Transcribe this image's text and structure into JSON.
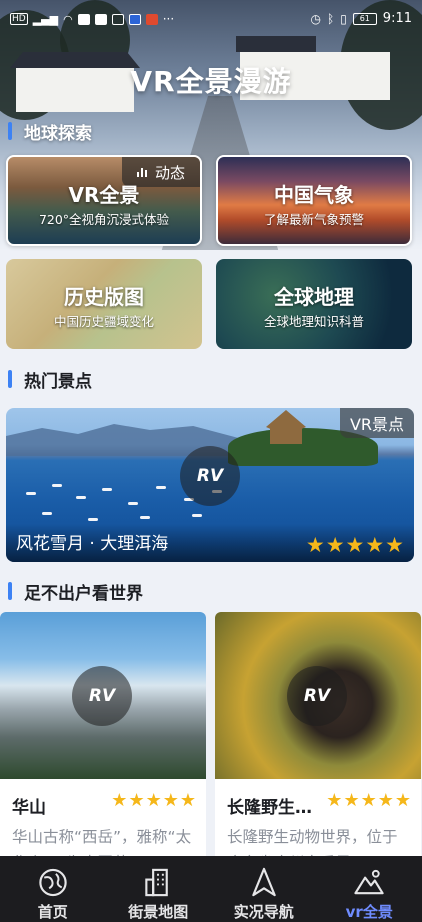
{
  "status_bar": {
    "time": "9:11",
    "battery": "61",
    "left_text": "HD",
    "more": "···"
  },
  "hero": {
    "title": "VR全景漫游"
  },
  "section_explore": {
    "title": "地球探索"
  },
  "grid": [
    {
      "title": "VR全景",
      "subtitle": "720°全视角沉浸式体验",
      "badge": "动态"
    },
    {
      "title": "中国气象",
      "subtitle": "了解最新气象预警"
    },
    {
      "title": "历史版图",
      "subtitle": "中国历史疆域变化"
    },
    {
      "title": "全球地理",
      "subtitle": "全球地理知识科普"
    }
  ],
  "section_hot": {
    "title": "热门景点"
  },
  "featured": {
    "tag": "VR景点",
    "rv": "RV",
    "name": "风花雪月 · 大理洱海",
    "stars": 5
  },
  "section_world": {
    "title": "足不出户看世界"
  },
  "cards": [
    {
      "name": "华山",
      "rv": "RV",
      "stars": 5,
      "desc": "华山古称“西岳”，雅称“太华山”，为中国著"
    },
    {
      "name": "长隆野生…",
      "rv": "RV",
      "stars": 5,
      "desc": "长隆野生动物世界，位于广东省广州市番禺"
    }
  ],
  "tabbar": [
    {
      "label": "首页",
      "icon": "globe-icon",
      "active": false
    },
    {
      "label": "街景地图",
      "icon": "building-icon",
      "active": false
    },
    {
      "label": "实况导航",
      "icon": "navigation-icon",
      "active": false
    },
    {
      "label": "vr全景",
      "icon": "mountain-icon",
      "active": true
    }
  ],
  "colors": {
    "accent": "#3d82f4",
    "active_tab": "#6f8cff",
    "star": "#f5b71a",
    "tabbar_bg": "#1c1c1f"
  }
}
